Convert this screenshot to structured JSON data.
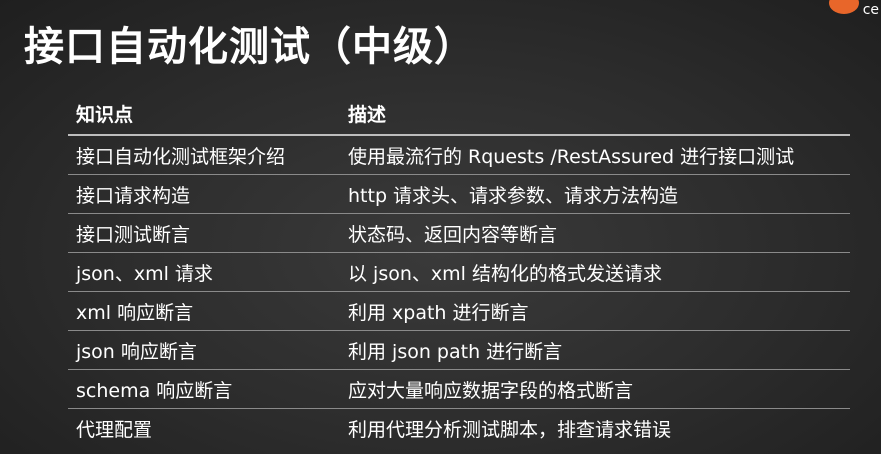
{
  "brand": {
    "logo_text": "ce"
  },
  "title": "接口自动化测试（中级）",
  "table": {
    "headers": [
      "知识点",
      "描述"
    ],
    "rows": [
      [
        "接口自动化测试框架介绍",
        "使用最流行的 Rquests /RestAssured 进行接口测试"
      ],
      [
        "接口请求构造",
        "http 请求头、请求参数、请求方法构造"
      ],
      [
        "接口测试断言",
        "状态码、返回内容等断言"
      ],
      [
        "json、xml 请求",
        "以 json、xml 结构化的格式发送请求"
      ],
      [
        "xml 响应断言",
        "利用 xpath 进行断言"
      ],
      [
        "json 响应断言",
        "利用 json path 进行断言"
      ],
      [
        "schema 响应断言",
        "应对大量响应数据字段的格式断言"
      ],
      [
        "代理配置",
        "利用代理分析测试脚本，排查请求错误"
      ]
    ]
  },
  "colors": {
    "background": "#2c2c2c",
    "text": "#ffffff",
    "logo_accent": "#e8662a"
  }
}
